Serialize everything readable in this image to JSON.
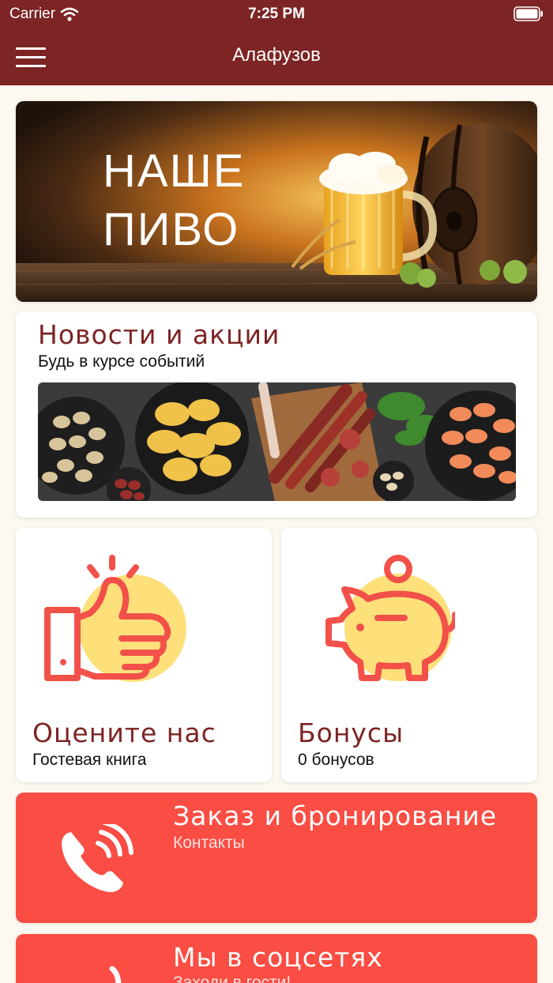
{
  "status_bar": {
    "carrier": "Carrier",
    "time": "7:25 PM"
  },
  "nav": {
    "title": "Алафузов"
  },
  "banner": {
    "line1": "НАШЕ",
    "line2": "ПИВО"
  },
  "news": {
    "title": "Новости и акции",
    "subtitle": "Будь в курсе событий"
  },
  "rate": {
    "title": "Оцените нас",
    "subtitle": "Гостевая книга"
  },
  "bonus": {
    "title": "Бонусы",
    "subtitle": "0 бонусов"
  },
  "order": {
    "title": "Заказ и бронирование",
    "subtitle": "Контакты"
  },
  "social": {
    "title": "Мы в соцсетях",
    "subtitle": "Заходи в гости!"
  },
  "colors": {
    "header": "#7d2424",
    "accent": "#fa4d43",
    "icon_bg": "#fde07a",
    "background": "#fdf9f0"
  },
  "icons": [
    "menu-icon",
    "wifi-icon",
    "battery-icon",
    "thumbs-up-icon",
    "piggy-bank-icon",
    "phone-icon"
  ]
}
